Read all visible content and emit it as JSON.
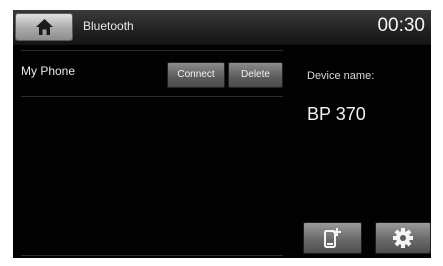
{
  "header": {
    "title": "Bluetooth",
    "time": "00:30",
    "home_icon": "home-icon"
  },
  "device_list": {
    "items": [
      {
        "name": "My Phone",
        "connect_label": "Connect",
        "delete_label": "Delete"
      }
    ]
  },
  "device_info": {
    "label": "Device name:",
    "value": "BP 370"
  },
  "actions": {
    "pair_icon": "phone-add-icon",
    "settings_icon": "gear-icon"
  },
  "colors": {
    "background": "#020202",
    "text": "#eaeaea",
    "button": "#6a6a6a"
  }
}
